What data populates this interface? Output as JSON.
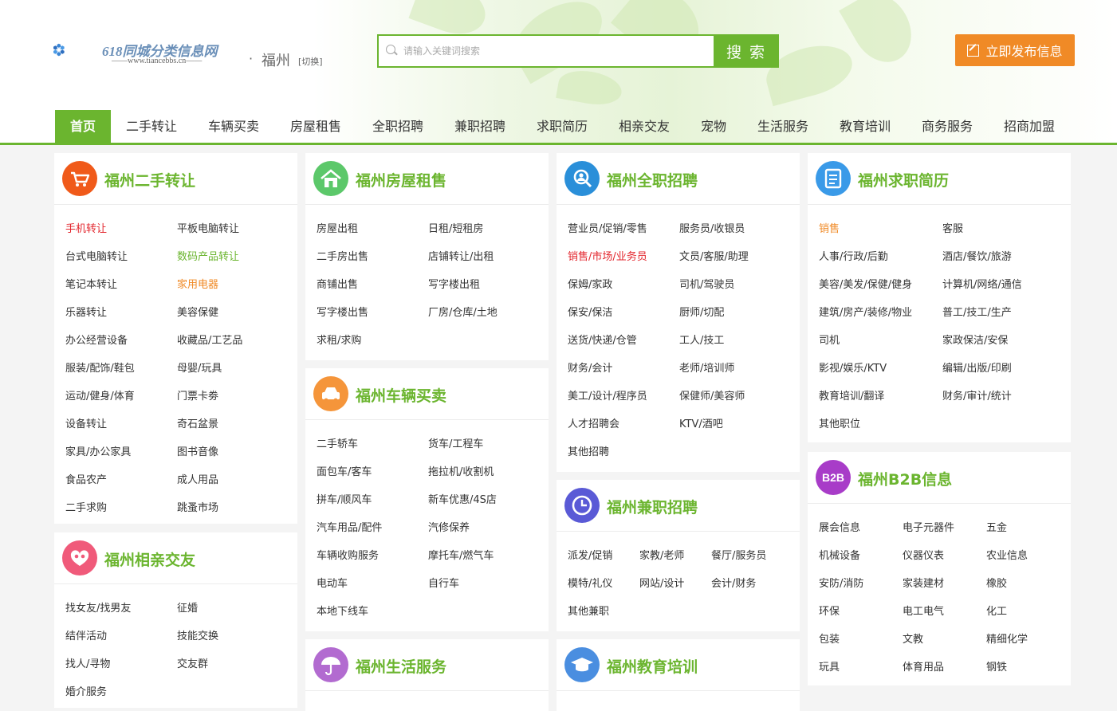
{
  "header": {
    "logo_title": "618同城分类信息网",
    "logo_url": "www.tiancebbs.cn",
    "city_dot": "·",
    "city": "福州",
    "switch_label": "[切换]",
    "search_placeholder": "请输入关键词搜索",
    "search_button": "搜 索",
    "publish_button": "立即发布信息"
  },
  "nav": [
    {
      "label": "首页",
      "active": true
    },
    {
      "label": "二手转让"
    },
    {
      "label": "车辆买卖"
    },
    {
      "label": "房屋租售"
    },
    {
      "label": "全职招聘"
    },
    {
      "label": "兼职招聘"
    },
    {
      "label": "求职简历"
    },
    {
      "label": "相亲交友"
    },
    {
      "label": "宠物"
    },
    {
      "label": "生活服务"
    },
    {
      "label": "教育培训"
    },
    {
      "label": "商务服务"
    },
    {
      "label": "招商加盟"
    }
  ],
  "colors": {
    "accent": "#6bb52f",
    "orange": "#f08a26",
    "red": "#e3262d"
  },
  "cards": {
    "secondhand": {
      "title": "福州二手转让",
      "icon": "shopping-cart-icon",
      "icon_color": "#f05a1a",
      "links": [
        {
          "text": "手机转让",
          "color": "red"
        },
        {
          "text": "平板电脑转让"
        },
        {
          "text": "台式电脑转让"
        },
        {
          "text": "数码产品转让",
          "color": "green"
        },
        {
          "text": "笔记本转让"
        },
        {
          "text": "家用电器",
          "color": "orange"
        },
        {
          "text": "乐器转让"
        },
        {
          "text": "美容保健"
        },
        {
          "text": "办公经营设备"
        },
        {
          "text": "收藏品/工艺品"
        },
        {
          "text": "服装/配饰/鞋包"
        },
        {
          "text": "母婴/玩具"
        },
        {
          "text": "运动/健身/体育"
        },
        {
          "text": "门票卡劵"
        },
        {
          "text": "设备转让"
        },
        {
          "text": "奇石盆景"
        },
        {
          "text": "家具/办公家具"
        },
        {
          "text": "图书音像"
        },
        {
          "text": "食品农产"
        },
        {
          "text": "成人用品"
        },
        {
          "text": "二手求购"
        },
        {
          "text": "跳蚤市场"
        }
      ]
    },
    "dating": {
      "title": "福州相亲交友",
      "icon": "heart-people-icon",
      "icon_color": "#f05a7a",
      "links": [
        {
          "text": "找女友/找男友"
        },
        {
          "text": "征婚"
        },
        {
          "text": "结伴活动"
        },
        {
          "text": "技能交换"
        },
        {
          "text": "找人/寻物"
        },
        {
          "text": "交友群"
        },
        {
          "text": "婚介服务"
        }
      ]
    },
    "housing": {
      "title": "福州房屋租售",
      "icon": "house-icon",
      "icon_color": "#5cc86a",
      "links": [
        {
          "text": "房屋出租"
        },
        {
          "text": "日租/短租房"
        },
        {
          "text": "二手房出售"
        },
        {
          "text": "店铺转让/出租"
        },
        {
          "text": "商铺出售"
        },
        {
          "text": "写字楼出租"
        },
        {
          "text": "写字楼出售"
        },
        {
          "text": "厂房/仓库/土地"
        },
        {
          "text": "求租/求购"
        }
      ]
    },
    "vehicles": {
      "title": "福州车辆买卖",
      "icon": "car-icon",
      "icon_color": "#f5953a",
      "links": [
        {
          "text": "二手轿车"
        },
        {
          "text": "货车/工程车"
        },
        {
          "text": "面包车/客车"
        },
        {
          "text": "拖拉机/收割机"
        },
        {
          "text": "拼车/顺风车"
        },
        {
          "text": "新车优惠/4S店"
        },
        {
          "text": "汽车用品/配件"
        },
        {
          "text": "汽修保养"
        },
        {
          "text": "车辆收购服务"
        },
        {
          "text": "摩托车/燃气车"
        },
        {
          "text": "电动车"
        },
        {
          "text": "自行车"
        },
        {
          "text": "本地下线车"
        }
      ]
    },
    "life": {
      "title": "福州生活服务",
      "icon": "umbrella-icon",
      "icon_color": "#b26bd0",
      "links": []
    },
    "fulltime": {
      "title": "福州全职招聘",
      "icon": "magnifier-person-icon",
      "icon_color": "#2a8fd9",
      "links": [
        {
          "text": "营业员/促销/零售"
        },
        {
          "text": "服务员/收银员"
        },
        {
          "text": "销售/市场/业务员",
          "color": "red"
        },
        {
          "text": "文员/客服/助理"
        },
        {
          "text": "保姆/家政"
        },
        {
          "text": "司机/驾驶员"
        },
        {
          "text": "保安/保洁"
        },
        {
          "text": "厨师/切配"
        },
        {
          "text": "送货/快递/仓管"
        },
        {
          "text": "工人/技工"
        },
        {
          "text": "财务/会计"
        },
        {
          "text": "老师/培训师"
        },
        {
          "text": "美工/设计/程序员"
        },
        {
          "text": "保健师/美容师"
        },
        {
          "text": "人才招聘会"
        },
        {
          "text": "KTV/酒吧"
        },
        {
          "text": "其他招聘"
        }
      ]
    },
    "parttime": {
      "title": "福州兼职招聘",
      "icon": "clock-icon",
      "icon_color": "#5a5ad6",
      "links": [
        {
          "text": "派发/促销"
        },
        {
          "text": "家教/老师"
        },
        {
          "text": "餐厅/服务员"
        },
        {
          "text": "模特/礼仪"
        },
        {
          "text": "网站/设计"
        },
        {
          "text": "会计/财务"
        },
        {
          "text": "其他兼职"
        }
      ]
    },
    "education": {
      "title": "福州教育培训",
      "icon": "graduation-cap-icon",
      "icon_color": "#4a8ee0",
      "links": []
    },
    "resume": {
      "title": "福州求职简历",
      "icon": "document-list-icon",
      "icon_color": "#3a9ae8",
      "links": [
        {
          "text": "销售",
          "color": "orange"
        },
        {
          "text": "客服"
        },
        {
          "text": "人事/行政/后勤"
        },
        {
          "text": "酒店/餐饮/旅游"
        },
        {
          "text": "美容/美发/保健/健身"
        },
        {
          "text": "计算机/网络/通信"
        },
        {
          "text": "建筑/房产/装修/物业"
        },
        {
          "text": "普工/技工/生产"
        },
        {
          "text": "司机"
        },
        {
          "text": "家政保洁/安保"
        },
        {
          "text": "影视/娱乐/KTV"
        },
        {
          "text": "编辑/出版/印刷"
        },
        {
          "text": "教育培训/翻译"
        },
        {
          "text": "财务/审计/统计"
        },
        {
          "text": "其他职位"
        }
      ]
    },
    "b2b": {
      "title": "福州B2B信息",
      "icon": "b2b-icon",
      "icon_label": "B2B",
      "icon_color": "#a83cc8",
      "links": [
        {
          "text": "展会信息"
        },
        {
          "text": "电子元器件"
        },
        {
          "text": "五金"
        },
        {
          "text": "机械设备"
        },
        {
          "text": "仪器仪表"
        },
        {
          "text": "农业信息"
        },
        {
          "text": "安防/消防"
        },
        {
          "text": "家装建材"
        },
        {
          "text": "橡胶"
        },
        {
          "text": "环保"
        },
        {
          "text": "电工电气"
        },
        {
          "text": "化工"
        },
        {
          "text": "包装"
        },
        {
          "text": "文教"
        },
        {
          "text": "精细化学"
        },
        {
          "text": "玩具"
        },
        {
          "text": "体育用品"
        },
        {
          "text": "钢铁"
        }
      ]
    }
  }
}
